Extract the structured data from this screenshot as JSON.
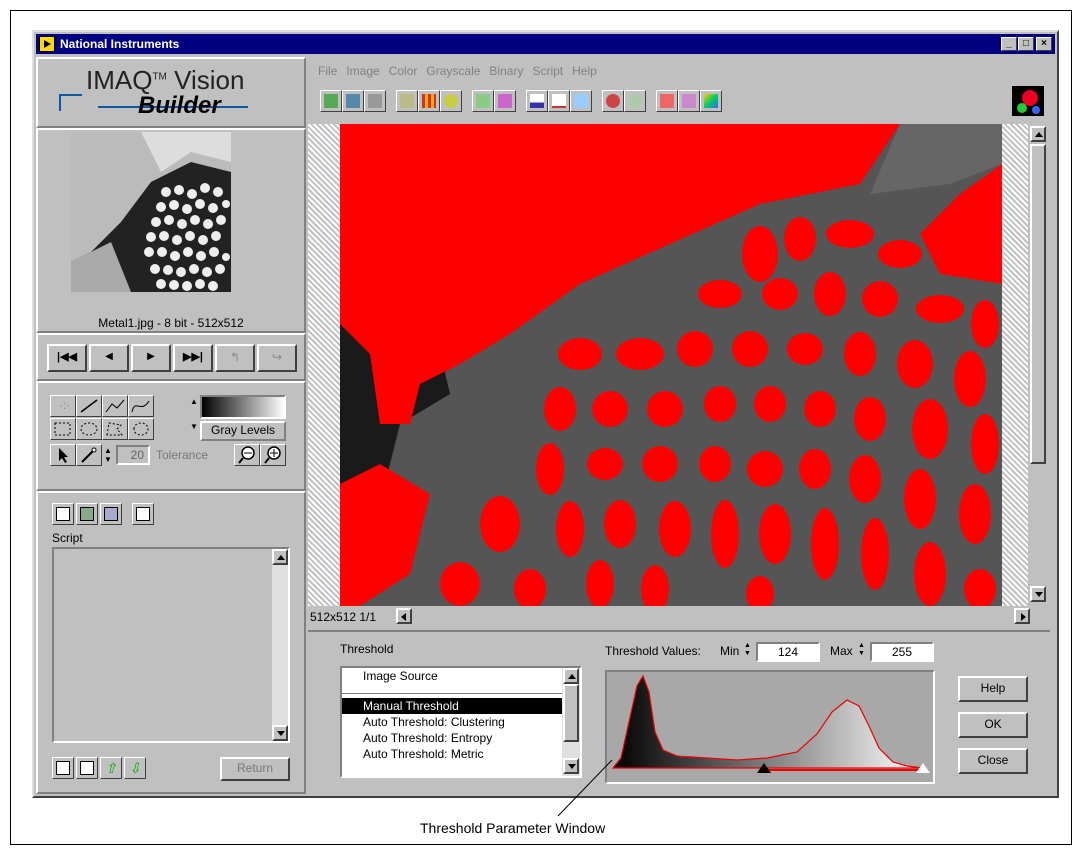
{
  "window": {
    "title": "National Instruments"
  },
  "logo": {
    "line1": "IMAQ",
    "tm": "TM",
    "line1b": " Vision",
    "line2": "Builder"
  },
  "menu": [
    "File",
    "Image",
    "Color",
    "Grayscale",
    "Binary",
    "Script",
    "Help"
  ],
  "toolbar_icons": [
    "acquire-icon",
    "browse-icon",
    "print-icon",
    "process-icon",
    "grid-icon",
    "gear-icon",
    "measure-icon",
    "eraser-icon",
    "histogram-icon",
    "line-profile-icon",
    "calibrate-icon",
    "particle-icon",
    "zoom-icon",
    "pattern-icon",
    "tree-icon",
    "color-icon"
  ],
  "thumbnail": {
    "caption": "Metal1.jpg - 8 bit - 512x512"
  },
  "nav_buttons": [
    "first-icon",
    "prev-icon",
    "next-icon",
    "last-icon",
    "back-icon",
    "forward-icon"
  ],
  "tools": {
    "tolerance_value": "20",
    "tolerance_label": "Tolerance",
    "gray_levels_label": "Gray Levels"
  },
  "script": {
    "label": "Script",
    "return_label": "Return"
  },
  "image_panel": {
    "status": "512x512 1/1"
  },
  "threshold": {
    "label": "Threshold",
    "list": [
      "Image Source",
      "",
      "Manual Threshold",
      "Auto Threshold: Clustering",
      "Auto Threshold: Entropy",
      "Auto Threshold: Metric"
    ],
    "selected_index": 2,
    "values_label": "Threshold Values:",
    "min_label": "Min",
    "min_value": "124",
    "max_label": "Max",
    "max_value": "255",
    "min_fraction": 0.486,
    "max_fraction": 1.0
  },
  "buttons": {
    "help": "Help",
    "ok": "OK",
    "close": "Close"
  },
  "callout": {
    "text": "Threshold Parameter Window"
  },
  "colors": {
    "title_bar": "#000080",
    "overlay": "#ff0000",
    "face": "#c0c0c0"
  }
}
